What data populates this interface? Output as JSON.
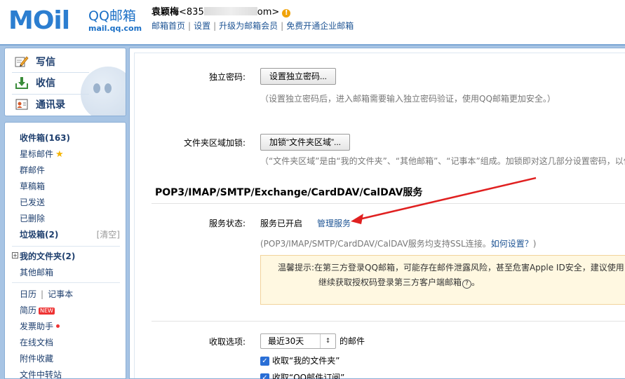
{
  "header": {
    "logo_word": "MOil",
    "logo_brand": "QQ邮箱",
    "logo_url": "mail.qq.com",
    "user_name": "袁颖梅",
    "user_email_prefix": "<835",
    "user_email_suffix": "om>",
    "warn_glyph": "!",
    "links": [
      "邮箱首页",
      "设置",
      "升级为邮箱会员",
      "免费开通企业邮箱"
    ]
  },
  "sidebar": {
    "compose": "写信",
    "inbox": "收信",
    "contacts": "通讯录",
    "folders": {
      "inbox": "收件箱(163)",
      "starred": "星标邮件",
      "group": "群邮件",
      "drafts": "草稿箱",
      "sent": "已发送",
      "deleted": "已删除",
      "spam": "垃圾箱(2)",
      "spam_clear": "[清空]",
      "myfolders": "我的文件夹(2)",
      "myfolders_toggle": "+",
      "other": "其他邮箱",
      "calendar": "日历",
      "notes": "记事本",
      "resume": "简历",
      "resume_badge": "NEW",
      "invoice": "发票助手",
      "docs": "在线文档",
      "attachments": "附件收藏",
      "transfer": "文件中转站"
    }
  },
  "main": {
    "pwd_label": "独立密码:",
    "pwd_button": "设置独立密码...",
    "pwd_hint": "（设置独立密码后，进入邮箱需要输入独立密码验证，使用QQ邮箱更加安全。）",
    "lock_label": "文件夹区域加锁:",
    "lock_button": "加锁“文件夹区域”...",
    "lock_hint": "（“文件夹区域”是由“我的文件夹”、“其他邮箱”、“记事本”组成。加锁即对这几部分设置密码，以保护",
    "section_title": "POP3/IMAP/SMTP/Exchange/CardDAV/CalDAV服务",
    "status_label": "服务状态:",
    "status_value": "服务已开启",
    "manage_link": "管理服务",
    "ssl_hint": "(POP3/IMAP/SMTP/CardDAV/CalDAV服务均支持SSL连接。",
    "ssl_howto": "如何设置？",
    "ssl_hint_end": ")",
    "warning_label": "温馨提示:",
    "warning_line1": "在第三方登录QQ邮箱，可能存在邮件泄露风险，甚至危害Apple ID安全，建议使用",
    "warning_line2": "继续获取授权码登录第三方客户端邮箱",
    "help_glyph": "?",
    "recv_label": "收取选项:",
    "recv_select": "最近30天",
    "recv_suffix": "的邮件",
    "cb1": "收取“我的文件夹”",
    "cb2": "收取“QQ邮件订阅”"
  },
  "colors": {
    "brand_blue": "#2c7ed0",
    "link": "#1e5494",
    "frame": "#a7c4e4",
    "arrow": "#e02020",
    "warn_bg": "#fff8e1"
  }
}
